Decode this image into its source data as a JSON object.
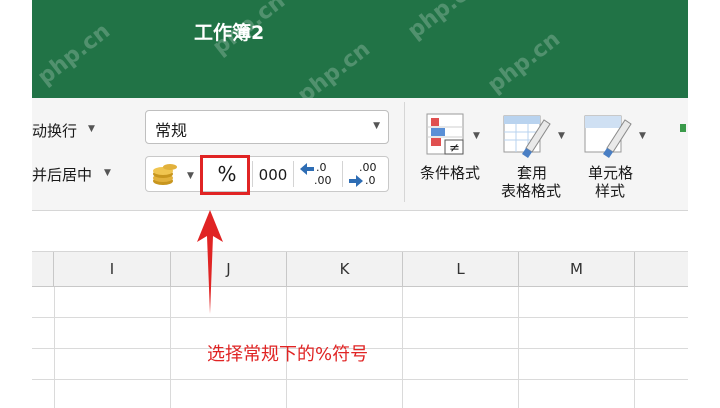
{
  "window": {
    "title": "工作簿2"
  },
  "ribbon": {
    "wrap_text_label": "动换行",
    "merge_center_label": "并后居中",
    "number_format": {
      "selected": "常规"
    },
    "percent_label": "%",
    "thousands_label": "000",
    "increase_decimal": {
      "top": ".0",
      "bottom": ".00"
    },
    "decrease_decimal": {
      "top": ".00",
      "bottom": ".0"
    },
    "conditional_format_label": "条件格式",
    "table_format_label_1": "套用",
    "table_format_label_2": "表格格式",
    "cell_style_label_1": "单元格",
    "cell_style_label_2": "样式"
  },
  "columns": [
    "I",
    "J",
    "K",
    "L",
    "M"
  ],
  "annotation": {
    "caption": "选择常规下的%符号",
    "color": "#e02424"
  },
  "colors": {
    "title_bar": "#217346",
    "highlight": "#e02424"
  },
  "watermark": "php.cn"
}
